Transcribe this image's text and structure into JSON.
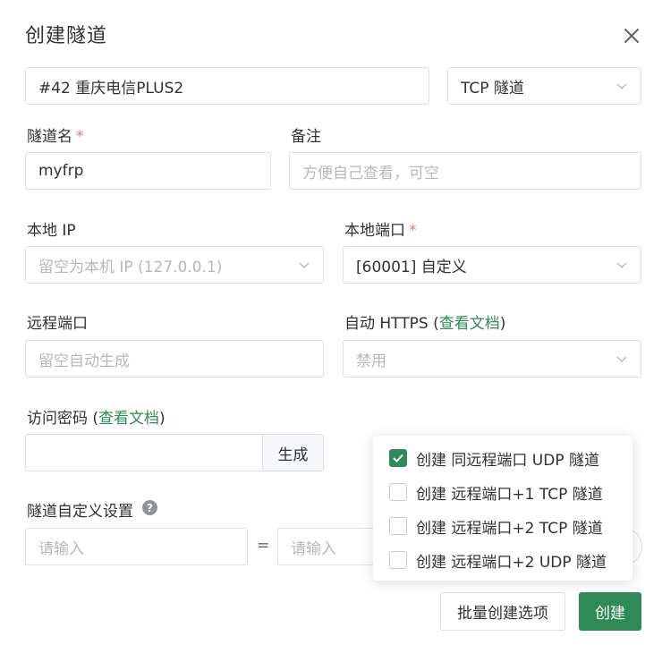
{
  "dialog": {
    "title": "创建隧道"
  },
  "node_select": {
    "value": "#42 重庆电信PLUS2"
  },
  "type_select": {
    "value": "TCP 隧道"
  },
  "tunnel_name": {
    "label": "隧道名",
    "required_mark": "*",
    "value": "myfrp"
  },
  "remark": {
    "label": "备注",
    "placeholder": "方便自己查看，可空"
  },
  "local_ip": {
    "label": "本地 IP",
    "placeholder": "留空为本机 IP (127.0.0.1)"
  },
  "local_port": {
    "label": "本地端口",
    "required_mark": "*",
    "value": "[60001] 自定义"
  },
  "remote_port": {
    "label": "远程端口",
    "placeholder": "留空自动生成"
  },
  "auto_https": {
    "label": "自动 HTTPS (",
    "link": "查看文档",
    "label_end": ")",
    "placeholder": "禁用"
  },
  "access_password": {
    "label": "访问密码 (",
    "link": "查看文档",
    "label_end": ")",
    "value": "",
    "generate_label": "生成"
  },
  "custom_settings": {
    "label": "隧道自定义设置",
    "help_icon": "?",
    "key_placeholder": "请输入",
    "equals": "=",
    "value_placeholder": "请输入"
  },
  "batch_options": {
    "items": [
      {
        "label": "创建 同远程端口 UDP 隧道",
        "checked": true
      },
      {
        "label": "创建 远程端口+1 TCP 隧道",
        "checked": false
      },
      {
        "label": "创建 远程端口+2 TCP 隧道",
        "checked": false
      },
      {
        "label": "创建 远程端口+2 UDP 隧道",
        "checked": false
      }
    ]
  },
  "footer": {
    "batch_button": "批量创建选项",
    "create_button": "创建"
  },
  "colors": {
    "accent": "#2e8b57",
    "required": "#f56c6c",
    "border": "#dcdfe6",
    "placeholder": "#b5b8bf"
  }
}
